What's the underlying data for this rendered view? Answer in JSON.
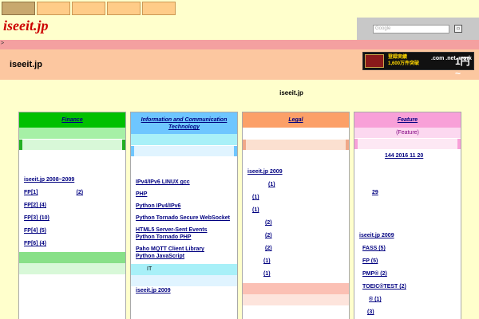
{
  "logo": "iseeit.jp",
  "search": {
    "placeholder": "Google",
    "button": "▭"
  },
  "band_mark": ">",
  "site_title": "iseeit.jp",
  "banner": {
    "line1": "登録実績",
    "line2": "1,600万件突破",
    "domain": ".com .net .work",
    "price": "1円~"
  },
  "center_title": "iseeit.jp",
  "columns": [
    {
      "title": "Finance",
      "items": [
        "iseeit.jp       2008~2009",
        "FP[1]",
        "FP[2]       (4)",
        "FP[3]       (10)",
        "FP[4]       (5)",
        "FP[6]       (4)"
      ],
      "counts": [
        "(2)"
      ],
      "lower_items": [
        "",
        "",
        ""
      ]
    },
    {
      "title": "Information and Communication Technology",
      "items": [
        "",
        "IPv4/IPv6                    LINUX gcc",
        "PHP",
        "Python IPv4/IPv6",
        "Python Tornado    Secure WebSocket",
        "HTML5 Server-Sent Events",
        "Python Tornado   PHP",
        "Paho  MQTT Client Library",
        "Python  JavaScript"
      ],
      "band": "IT",
      "lower_items": [
        "iseeit.jp          2009"
      ]
    },
    {
      "title": "Legal",
      "items": [
        "iseeit.jp      2009",
        "(1)",
        "(1)",
        "(1)",
        "(2)",
        "(2)",
        "(2)",
        "(1)",
        "(1)"
      ]
    },
    {
      "title": "Feature",
      "subtitle": "(Feature)",
      "items": [
        "144      2016  11  20",
        "",
        "29",
        "",
        "",
        "iseeit.jp           2009",
        "FASS (5)",
        "FP       (5)",
        "PMP® (2)",
        "TOEIC®TEST (2)",
        "® (1)",
        "(3)"
      ]
    }
  ]
}
